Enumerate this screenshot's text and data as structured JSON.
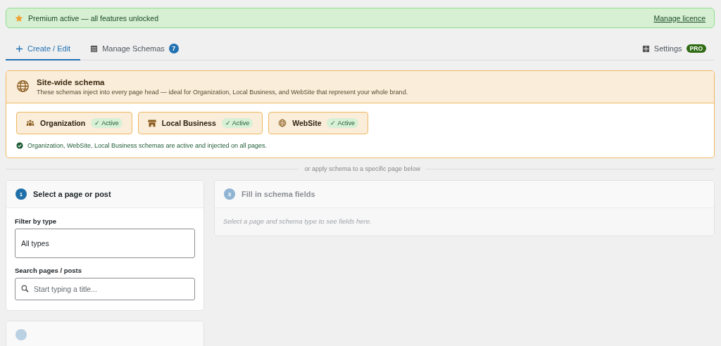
{
  "banner": {
    "text": "Premium active — all features unlocked",
    "link": "Manage licence"
  },
  "tabs": [
    {
      "label": "Create / Edit",
      "selected": true
    },
    {
      "label": "Manage Schemas",
      "selected": false,
      "badge": "7"
    }
  ],
  "settings": {
    "label": "Settings",
    "badge": "PRO"
  },
  "sitewide": {
    "title": "Site-wide schema",
    "description": "These schemas inject into every page head — ideal for Organization, Local Business, and WebSite that represent your whole brand.",
    "schemas": [
      {
        "name": "Organization",
        "status": "✓ Active",
        "active": true
      },
      {
        "name": "Local Business",
        "status": "✓ Active",
        "active": true
      },
      {
        "name": "WebSite",
        "status": "✓ Active",
        "active": true
      }
    ],
    "status_message": "Organization, WebSite, Local Business schemas are active and injected on all pages."
  },
  "divider_text": "or apply schema to a specific page below",
  "step_select": {
    "number": "1",
    "title": "Select a page or post",
    "active": true,
    "filter_label": "Filter by type",
    "filter_value": "All types",
    "search_label": "Search pages / posts",
    "search_placeholder": "Start typing a title..."
  },
  "step_fields": {
    "number": "3",
    "title": "Fill in schema fields",
    "active": false,
    "hint": "Select a page and schema type to see fields here."
  }
}
